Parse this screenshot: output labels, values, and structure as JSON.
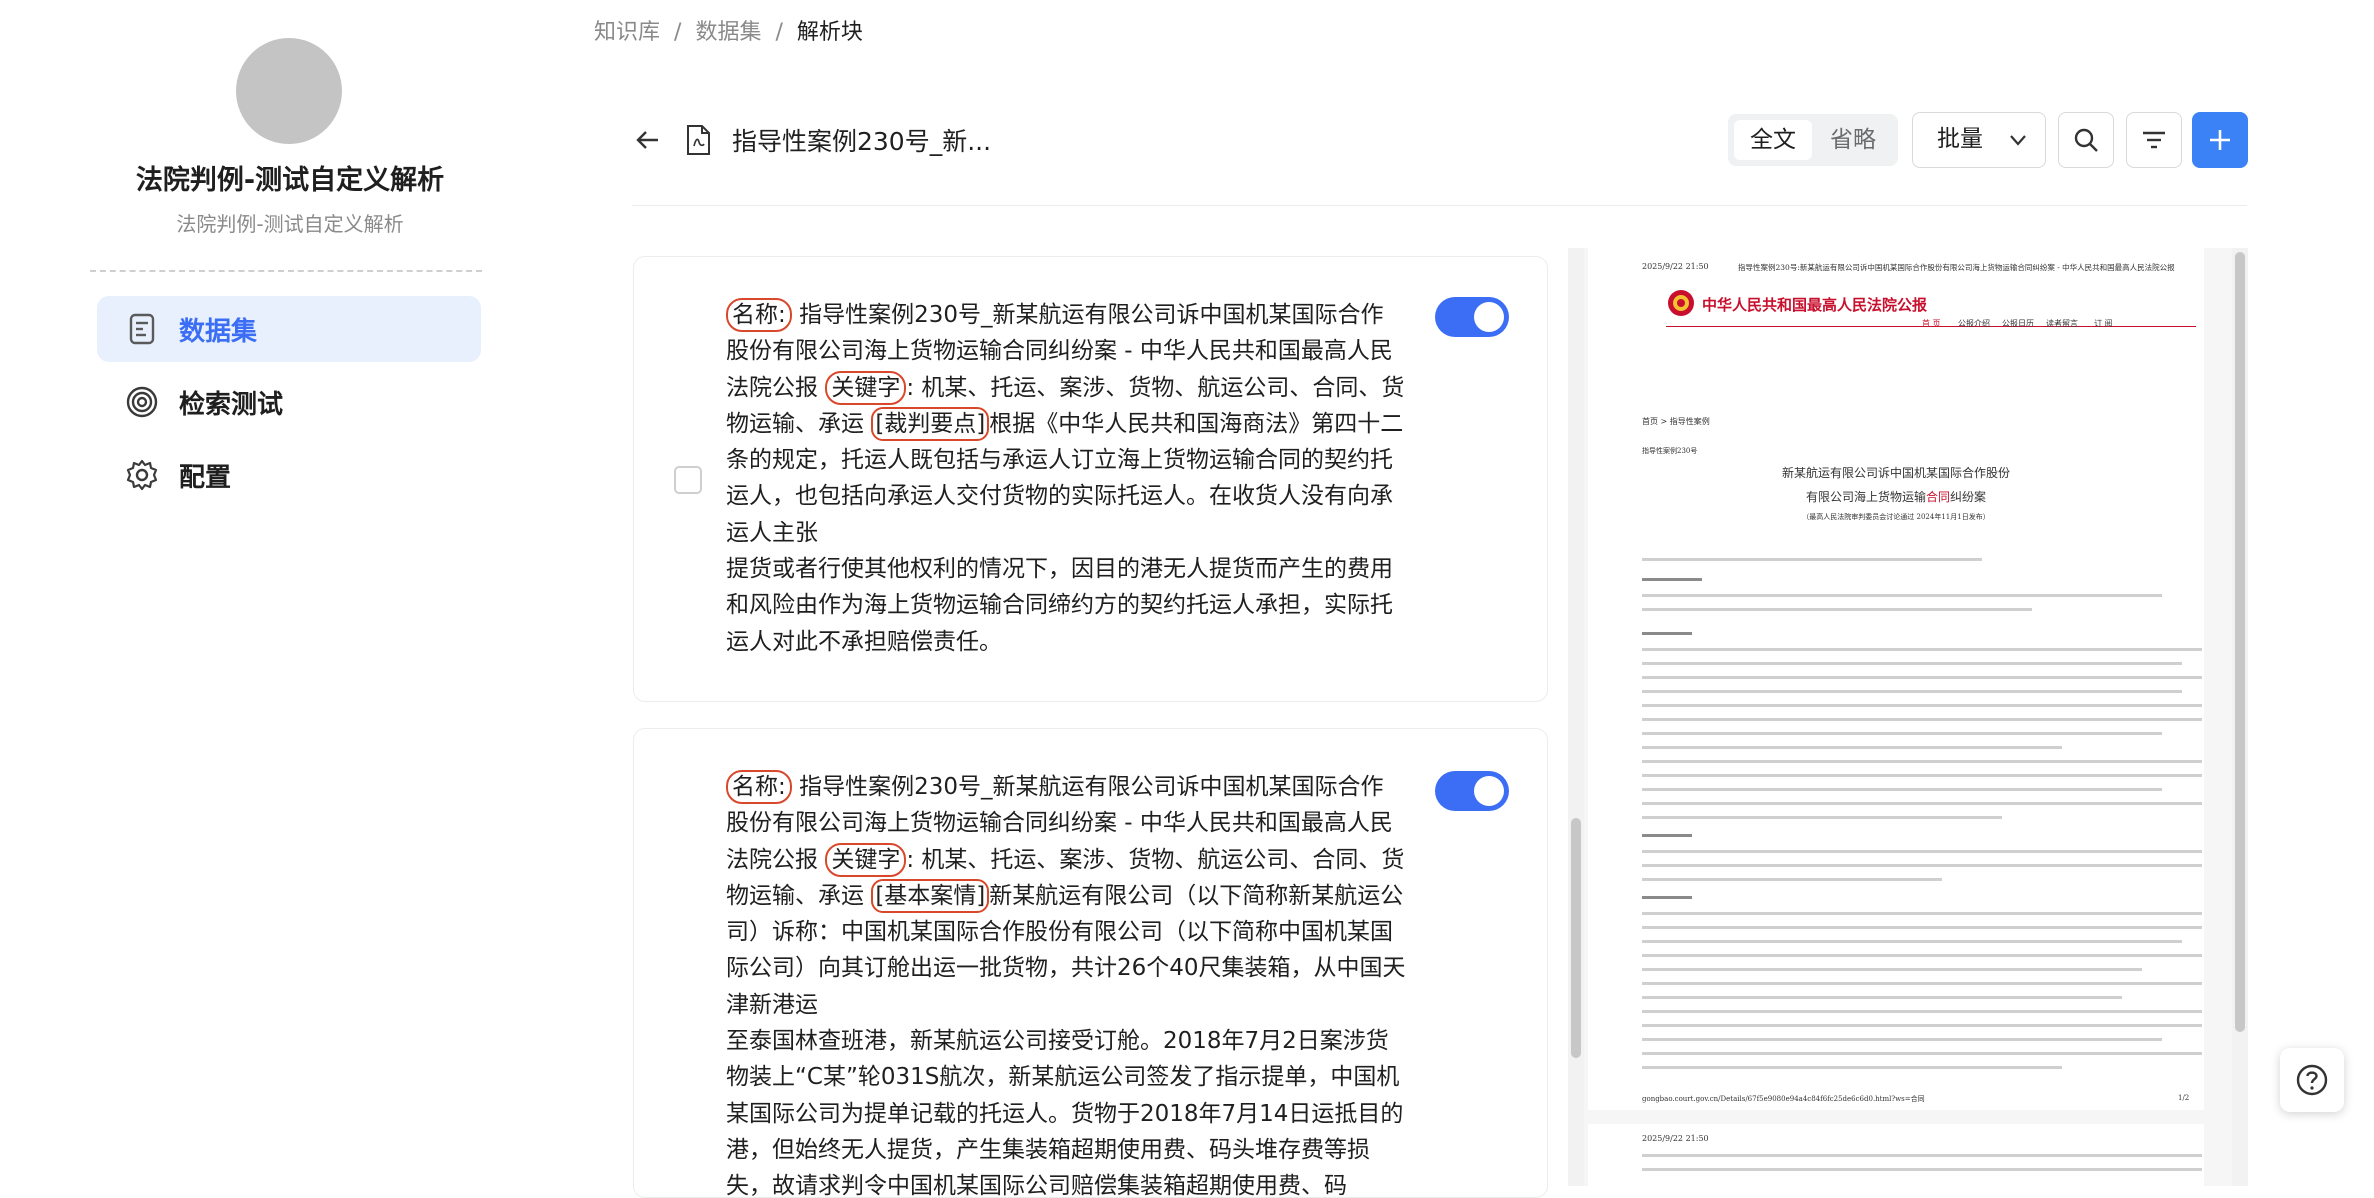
{
  "sidebar": {
    "kb_title": "法院判例-测试自定义解析",
    "kb_subtitle": "法院判例-测试自定义解析",
    "items": [
      {
        "label": "数据集",
        "icon": "dataset-icon",
        "active": true
      },
      {
        "label": "检索测试",
        "icon": "retrieval-icon",
        "active": false
      },
      {
        "label": "配置",
        "icon": "gear-icon",
        "active": false
      }
    ]
  },
  "breadcrumb": {
    "items": [
      "知识库",
      "数据集",
      "解析块"
    ],
    "separator": "/"
  },
  "toolbar": {
    "doc_title": "指导性案例230号_新...",
    "seg_full": "全文",
    "seg_omit": "省略",
    "batch_label": "批量",
    "icons": [
      "search-icon",
      "filter-icon",
      "plus-icon"
    ]
  },
  "chunks": [
    {
      "name_tag": "名称:",
      "name_text": "指导性案例230号_新某航运有限公司诉中国机某国际合作股份有限公司海上货物运输合同纠纷案 - 中华人民共和国最高人民法院公报",
      "kw_tag": "关键字",
      "kw_text": ": 机某、托运、案涉、货物、航运公司、合同、货物运输、承运",
      "section_tag": "[裁判要点]",
      "body1": "根据《中华人民共和国海商法》第四十二条的规定，托运人既包括与承运人订立海上货物运输合同的契约托运人，也包括向承运人交付货物的实际托运人。在收货人没有向承运人主张",
      "body2": "提货或者行使其他权利的情况下，因目的港无人提货而产生的费用和风险由作为海上货物运输合同缔约方的契约托运人承担，实际托运人对此不承担赔偿责任。",
      "enabled": true
    },
    {
      "name_tag": "名称:",
      "name_text": "指导性案例230号_新某航运有限公司诉中国机某国际合作股份有限公司海上货物运输合同纠纷案 - 中华人民共和国最高人民法院公报",
      "kw_tag": "关键字",
      "kw_text": ": 机某、托运、案涉、货物、航运公司、合同、货物运输、承运",
      "section_tag": "[基本案情]",
      "body1": "新某航运有限公司（以下简称新某航运公司）诉称：中国机某国际合作股份有限公司（以下简称中国机某国际公司）向其订舱出运一批货物，共计26个40尺集装箱，从中国天津新港运",
      "body2": "至泰国林查班港，新某航运公司接受订舱。2018年7月2日案涉货物装上“C某”轮031S航次，新某航运公司签发了指示提单，中国机某国际公司为提单记载的托运人。货物于2018年7月14日运抵目的港，但始终无人提货，产生集装箱超期使用费、码头堆存费等损失，故请求判令中国机某国际公司赔偿集装箱超期使用费、码",
      "enabled": true
    }
  ],
  "preview": {
    "date": "2025/9/22 21:50",
    "header_title": "指导性案例230号:新某航运有限公司诉中国机某国际合作股份有限公司海上货物运输合同纠纷案 - 中华人民共和国最高人民法院公报",
    "masthead": "中华人民共和国最高人民法院公报",
    "nav": [
      "首 页",
      "公报介绍",
      "公报日历",
      "读者留言",
      "订 阅"
    ],
    "crumb": "首页 > 指导性案例",
    "case_no": "指导性案例230号",
    "case_title_1": "新某航运有限公司诉中国机某国际合作股份",
    "case_title_2": "有限公司海上货物运输",
    "case_title_hl": "合同",
    "case_title_3": "纠纷案",
    "case_sub": "（最高人民法院审判委员会讨论通过 2024年11月1日发布）",
    "footer_url": "gongbao.court.gov.cn/Details/67f5e9080e94a4c84f6fc25de6c6d0.html?ws=合同",
    "footer_page": "1/2",
    "date2": "2025/9/22 21:50"
  }
}
